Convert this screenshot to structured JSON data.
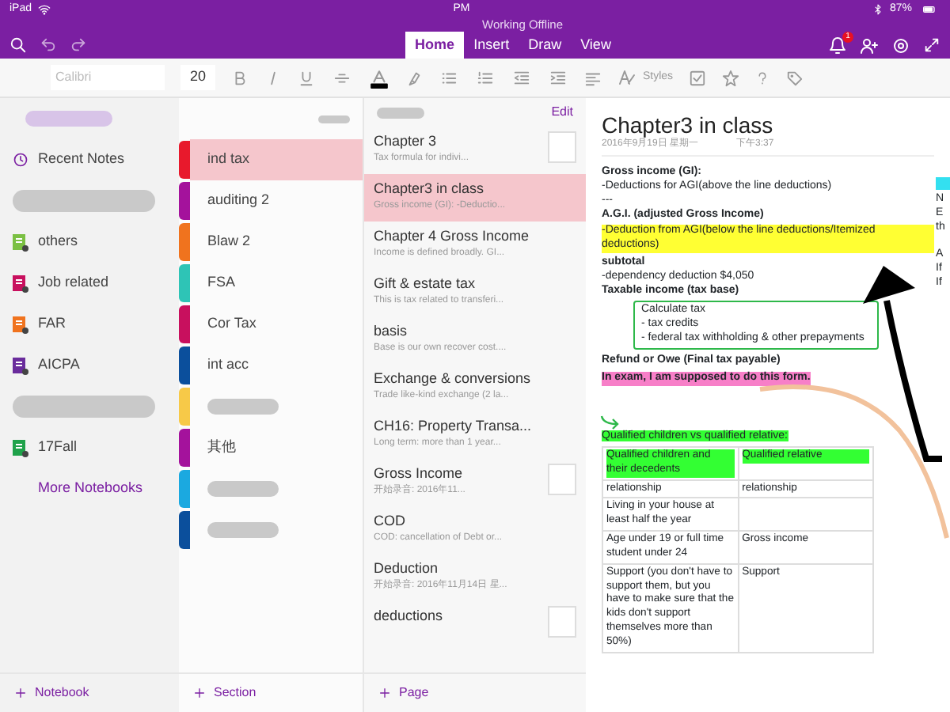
{
  "status_bar": {
    "device": "iPad",
    "time": "PM",
    "battery": "87%"
  },
  "title_bar": {
    "subtitle": "Working Offline",
    "notification_badge": "1",
    "tabs": [
      {
        "label": "Home",
        "selected": true
      },
      {
        "label": "Insert",
        "selected": false
      },
      {
        "label": "Draw",
        "selected": false
      },
      {
        "label": "View",
        "selected": false
      }
    ]
  },
  "toolbar": {
    "font": "Calibri",
    "size": "20",
    "styles_label": "Styles"
  },
  "notebooks": {
    "recent": "Recent Notes",
    "more": "More Notebooks",
    "add": "Notebook",
    "items": [
      {
        "kind": "redacted"
      },
      {
        "kind": "notebook",
        "label": "others",
        "color": "#7bc043"
      },
      {
        "kind": "notebook",
        "label": "Job related",
        "color": "#c8105e"
      },
      {
        "kind": "notebook",
        "label": "FAR",
        "color": "#f0731e"
      },
      {
        "kind": "notebook",
        "label": "AICPA",
        "color": "#6a2c9c"
      },
      {
        "kind": "redacted"
      },
      {
        "kind": "notebook",
        "label": "17Fall",
        "color": "#1fa24a"
      }
    ]
  },
  "sections": {
    "add": "Section",
    "items": [
      {
        "kind": "section",
        "label": "ind tax",
        "color": "#e8192c",
        "selected": true
      },
      {
        "kind": "section",
        "label": "auditing 2",
        "color": "#a4129c",
        "selected": false
      },
      {
        "kind": "section",
        "label": "Blaw 2",
        "color": "#f0731e",
        "selected": false
      },
      {
        "kind": "section",
        "label": "FSA",
        "color": "#2ec4b6",
        "selected": false
      },
      {
        "kind": "section",
        "label": "Cor Tax",
        "color": "#c8105e",
        "selected": false
      },
      {
        "kind": "section",
        "label": "int acc",
        "color": "#0b4f9c",
        "selected": false
      },
      {
        "kind": "redacted",
        "color": "#f7c948",
        "selected": false
      },
      {
        "kind": "section",
        "label": "其他",
        "color": "#a4129c",
        "selected": false
      },
      {
        "kind": "redacted",
        "color": "#1ba9e0",
        "selected": false
      },
      {
        "kind": "redacted",
        "color": "#0b4f9c",
        "selected": false
      }
    ]
  },
  "pages": {
    "edit": "Edit",
    "add": "Page",
    "items": [
      {
        "title": "Chapter 3",
        "preview": "Tax formula for indivi...",
        "selected": false,
        "thumbnail": true
      },
      {
        "title": "Chapter3 in class",
        "preview": "Gross income (GI):  -Deductio...",
        "selected": true,
        "thumbnail": false
      },
      {
        "title": "Chapter 4 Gross Income",
        "preview": "Income is defined broadly. GI...",
        "selected": false,
        "thumbnail": false
      },
      {
        "title": "Gift & estate tax",
        "preview": "This is tax related to transferi...",
        "selected": false,
        "thumbnail": false
      },
      {
        "title": "basis",
        "preview": "Base is our own recover cost....",
        "selected": false,
        "thumbnail": false
      },
      {
        "title": "Exchange & conversions",
        "preview": "Trade like-kind exchange (2 la...",
        "selected": false,
        "thumbnail": false
      },
      {
        "title": "CH16: Property Transa...",
        "preview": "Long term: more than 1 year...",
        "selected": false,
        "thumbnail": false
      },
      {
        "title": "Gross Income",
        "preview": "开始录音: 2016年11...",
        "selected": false,
        "thumbnail": true
      },
      {
        "title": "COD",
        "preview": "COD:  cancellation of Debt or...",
        "selected": false,
        "thumbnail": false
      },
      {
        "title": "Deduction",
        "preview": "开始录音: 2016年11月14日 星...",
        "selected": false,
        "thumbnail": false
      },
      {
        "title": "deductions",
        "selected": false,
        "thumbnail": true
      }
    ]
  },
  "note": {
    "title": "Chapter3 in class",
    "date": "2016年9月19日 星期一",
    "time": "下午3:37",
    "lines": [
      {
        "kind": "text",
        "text": "Gross income (GI):",
        "bold": true
      },
      {
        "kind": "text",
        "text": "-Deductions for AGI(above the line deductions)",
        "bold": false
      },
      {
        "kind": "text",
        "text": "---",
        "bold": false
      },
      {
        "kind": "text",
        "text": "A.G.I. (adjusted Gross Income)",
        "bold": true
      },
      {
        "kind": "text",
        "text": "-Deduction from AGI(below the line deductions/Itemized deductions)",
        "bold": false,
        "color": "#ffff33"
      },
      {
        "kind": "text",
        "text": "subtotal",
        "bold": true
      },
      {
        "kind": "text",
        "text": "-dependency deduction $4,050",
        "bold": false
      },
      {
        "kind": "text",
        "text": "Taxable income (tax base)",
        "bold": true
      },
      {
        "kind": "boxed",
        "items": [
          "Calculate tax",
          "-  tax credits",
          "- federal tax withholding & other prepayments"
        ]
      },
      {
        "kind": "text",
        "text": "Refund or Owe (Final tax payable)",
        "bold": true
      },
      {
        "kind": "text",
        "text": "In exam, I am supposed to do this form.",
        "bold": true,
        "color": "#f77fc8"
      }
    ],
    "table_caption": "Qualified children vs qualified relative:",
    "table_rows": [
      {
        "cells": [
          "Qualified children and their decedents",
          "Qualified relative"
        ],
        "color": "#33ff33"
      },
      {
        "cells": [
          "relationship",
          "relationship"
        ]
      },
      {
        "cells": [
          "Living in your house at least half the year",
          null
        ]
      },
      {
        "cells": [
          "Age under 19 or full time student under 24",
          "Gross income"
        ]
      },
      {
        "cells": [
          "Support  (you don't have to support them, but you have to make sure that the kids don't support themselves more than 50%)",
          "Support"
        ]
      }
    ],
    "edge_fragments": [
      "N",
      "E",
      "th",
      "A",
      "If",
      "If"
    ]
  }
}
